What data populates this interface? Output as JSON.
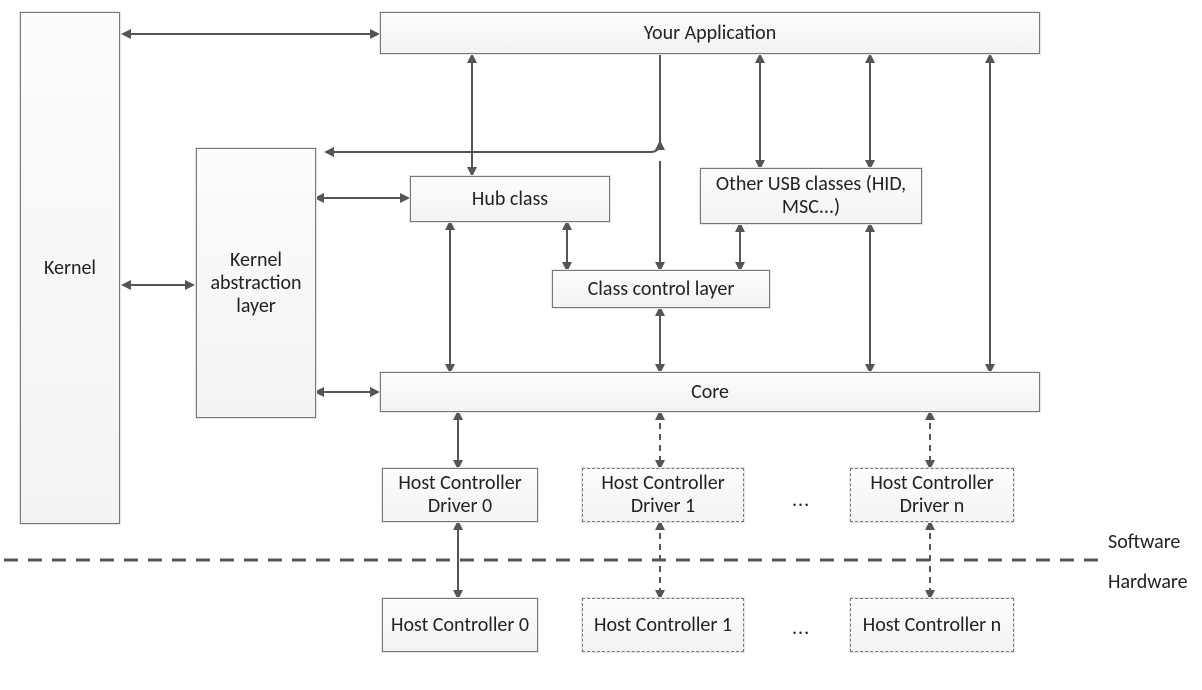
{
  "boxes": {
    "kernel": "Kernel",
    "kal": "Kernel abstraction layer",
    "app": "Your Application",
    "hub": "Hub class",
    "other": "Other USB classes (HID, MSC...)",
    "ccl": "Class control layer",
    "core": "Core",
    "hcd0": "Host Controller Driver 0",
    "hcd1": "Host Controller Driver 1",
    "hcdn": "Host Controller Driver n",
    "hc0": "Host Controller 0",
    "hc1": "Host Controller 1",
    "hcn": "Host Controller n"
  },
  "labels": {
    "software": "Software",
    "hardware": "Hardware",
    "dots": "..."
  }
}
